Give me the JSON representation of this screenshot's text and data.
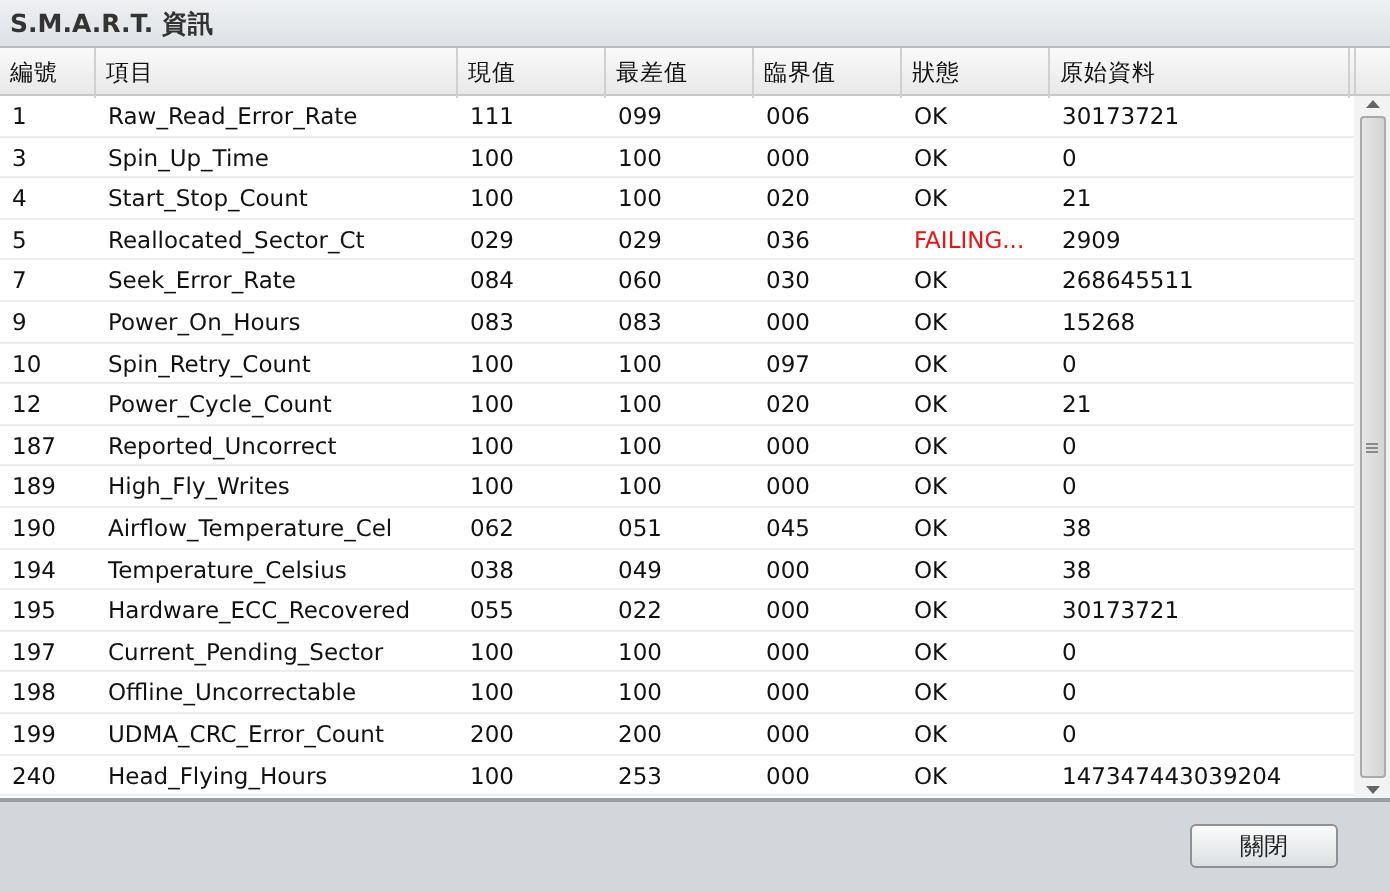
{
  "window": {
    "title": "S.M.A.R.T. 資訊"
  },
  "table": {
    "columns": [
      "編號",
      "項目",
      "現值",
      "最差值",
      "臨界值",
      "狀態",
      "原始資料"
    ],
    "rows": [
      {
        "id": "1",
        "name": "Raw_Read_Error_Rate",
        "current": "111",
        "worst": "099",
        "threshold": "006",
        "status": "OK",
        "failing": false,
        "raw": "30173721"
      },
      {
        "id": "3",
        "name": "Spin_Up_Time",
        "current": "100",
        "worst": "100",
        "threshold": "000",
        "status": "OK",
        "failing": false,
        "raw": "0"
      },
      {
        "id": "4",
        "name": "Start_Stop_Count",
        "current": "100",
        "worst": "100",
        "threshold": "020",
        "status": "OK",
        "failing": false,
        "raw": "21"
      },
      {
        "id": "5",
        "name": "Reallocated_Sector_Ct",
        "current": "029",
        "worst": "029",
        "threshold": "036",
        "status": "FAILING...",
        "failing": true,
        "raw": "2909"
      },
      {
        "id": "7",
        "name": "Seek_Error_Rate",
        "current": "084",
        "worst": "060",
        "threshold": "030",
        "status": "OK",
        "failing": false,
        "raw": "268645511"
      },
      {
        "id": "9",
        "name": "Power_On_Hours",
        "current": "083",
        "worst": "083",
        "threshold": "000",
        "status": "OK",
        "failing": false,
        "raw": "15268"
      },
      {
        "id": "10",
        "name": "Spin_Retry_Count",
        "current": "100",
        "worst": "100",
        "threshold": "097",
        "status": "OK",
        "failing": false,
        "raw": "0"
      },
      {
        "id": "12",
        "name": "Power_Cycle_Count",
        "current": "100",
        "worst": "100",
        "threshold": "020",
        "status": "OK",
        "failing": false,
        "raw": "21"
      },
      {
        "id": "187",
        "name": "Reported_Uncorrect",
        "current": "100",
        "worst": "100",
        "threshold": "000",
        "status": "OK",
        "failing": false,
        "raw": "0"
      },
      {
        "id": "189",
        "name": "High_Fly_Writes",
        "current": "100",
        "worst": "100",
        "threshold": "000",
        "status": "OK",
        "failing": false,
        "raw": "0"
      },
      {
        "id": "190",
        "name": "Airflow_Temperature_Cel",
        "current": "062",
        "worst": "051",
        "threshold": "045",
        "status": "OK",
        "failing": false,
        "raw": "38"
      },
      {
        "id": "194",
        "name": "Temperature_Celsius",
        "current": "038",
        "worst": "049",
        "threshold": "000",
        "status": "OK",
        "failing": false,
        "raw": "38"
      },
      {
        "id": "195",
        "name": "Hardware_ECC_Recovered",
        "current": "055",
        "worst": "022",
        "threshold": "000",
        "status": "OK",
        "failing": false,
        "raw": "30173721"
      },
      {
        "id": "197",
        "name": "Current_Pending_Sector",
        "current": "100",
        "worst": "100",
        "threshold": "000",
        "status": "OK",
        "failing": false,
        "raw": "0"
      },
      {
        "id": "198",
        "name": "Offline_Uncorrectable",
        "current": "100",
        "worst": "100",
        "threshold": "000",
        "status": "OK",
        "failing": false,
        "raw": "0"
      },
      {
        "id": "199",
        "name": "UDMA_CRC_Error_Count",
        "current": "200",
        "worst": "200",
        "threshold": "000",
        "status": "OK",
        "failing": false,
        "raw": "0"
      },
      {
        "id": "240",
        "name": "Head_Flying_Hours",
        "current": "100",
        "worst": "253",
        "threshold": "000",
        "status": "OK",
        "failing": false,
        "raw": "147347443039204"
      }
    ]
  },
  "buttons": [
    "關閉"
  ]
}
